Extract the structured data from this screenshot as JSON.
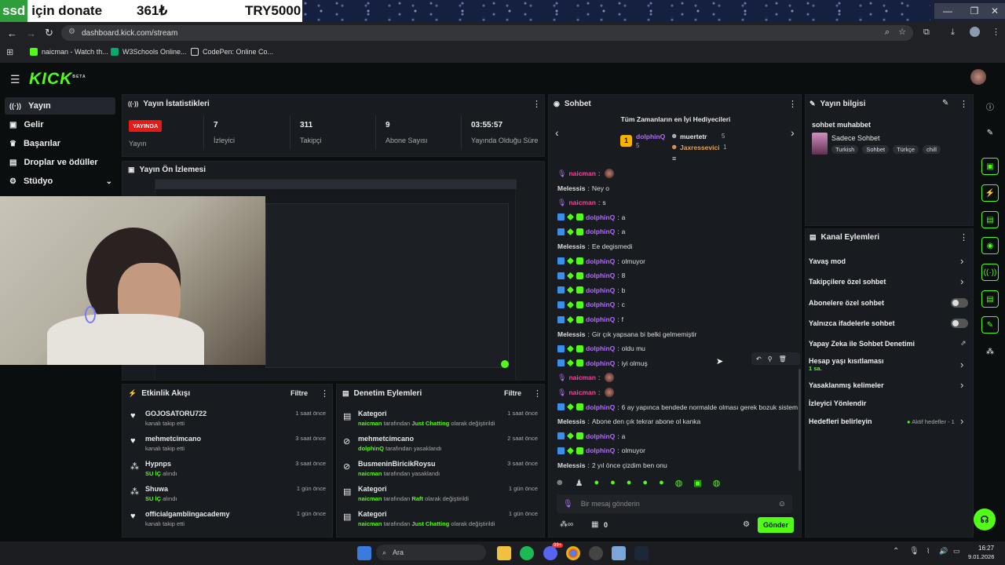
{
  "overlay": {
    "ssd": "ssd",
    "donate": "için donate",
    "amount1": "361₺",
    "amount2": "TRY5000"
  },
  "browser": {
    "url": "dashboard.kick.com/stream",
    "bookmarks": [
      "naicman - Watch th...",
      "W3Schools Online...",
      "CodePen: Online Co..."
    ]
  },
  "app": {
    "logo": "KICK",
    "logo_sup": "BETA"
  },
  "sidebar": {
    "items": [
      {
        "label": "Yayın",
        "icon": "broadcast-icon"
      },
      {
        "label": "Gelir",
        "icon": "wallet-icon"
      },
      {
        "label": "Başarılar",
        "icon": "trophy-icon"
      },
      {
        "label": "Droplar ve ödüller",
        "icon": "gift-icon"
      },
      {
        "label": "Stüdyo",
        "icon": "studio-icon"
      }
    ]
  },
  "stats": {
    "title": "Yayın İstatistikleri",
    "live_badge": "YAYINDA",
    "live_label": "Yayın",
    "items": [
      {
        "value": "7",
        "label": "İzleyici"
      },
      {
        "value": "311",
        "label": "Takipçi"
      },
      {
        "value": "9",
        "label": "Abone Sayısı"
      },
      {
        "value": "03:55:57",
        "label": "Yayında Olduğu Süre"
      }
    ]
  },
  "preview": {
    "title": "Yayın Ön İzlemesi"
  },
  "activity": {
    "title": "Etkinlik Akışı",
    "filter": "Filtre",
    "items": [
      {
        "name": "GOJOSATORU722",
        "sub": "kanalı takip etti",
        "time": "1 saat önce",
        "icon": "heart-icon",
        "subgreen": ""
      },
      {
        "name": "mehmetcimcano",
        "sub": "kanalı takip etti",
        "time": "3 saat önce",
        "icon": "heart-icon",
        "subgreen": ""
      },
      {
        "name": "Hypnps",
        "sub": "alındı",
        "time": "3 saat önce",
        "icon": "drop-icon",
        "subgreen": "SU İÇ"
      },
      {
        "name": "Shuwa",
        "sub": "alındı",
        "time": "1 gün önce",
        "icon": "drop-icon",
        "subgreen": "SU İÇ"
      },
      {
        "name": "officialgamblingacademy",
        "sub": "kanalı takip etti",
        "time": "1 gün önce",
        "icon": "heart-icon",
        "subgreen": ""
      }
    ]
  },
  "moderation": {
    "title": "Denetim Eylemleri",
    "filter": "Filtre",
    "items": [
      {
        "name": "Kategori",
        "actor": "naicman",
        "mid": "tarafından",
        "target": "Just Chatting",
        "tail": "olarak değiştirildi",
        "time": "1 saat önce",
        "icon": "category-icon"
      },
      {
        "name": "mehmetcimcano",
        "actor": "dolphinQ",
        "mid": "tarafından yasaklandı",
        "target": "",
        "tail": "",
        "time": "2 saat önce",
        "icon": "ban-icon"
      },
      {
        "name": "BusmeninBiricikRoysu",
        "actor": "naicman",
        "mid": "tarafından yasaklandı",
        "target": "",
        "tail": "",
        "time": "3 saat önce",
        "icon": "ban-icon"
      },
      {
        "name": "Kategori",
        "actor": "naicman",
        "mid": "tarafından",
        "target": "Raft",
        "tail": "olarak değiştirildi",
        "time": "1 gün önce",
        "icon": "category-icon"
      },
      {
        "name": "Kategori",
        "actor": "naicman",
        "mid": "tarafından",
        "target": "Just Chatting",
        "tail": "olarak değiştirildi",
        "time": "1 gün önce",
        "icon": "category-icon"
      }
    ]
  },
  "chat": {
    "title": "Sohbet",
    "top_title": "Tüm Zamanların en İyi Hediyecileri",
    "top_rank": "1",
    "top1_name": "dolphinQ",
    "top1_val": "5",
    "top2_name": "muertetr",
    "top2_val": "5",
    "top3_name": "Jaxressevici",
    "top3_val": "1",
    "placeholder": "Bir mesaj gönderin",
    "send": "Gönder",
    "footer_count": "0",
    "messages": [
      {
        "user": "naicman",
        "text": "",
        "type": "n"
      },
      {
        "user": "Melessis",
        "text": "Ney o",
        "type": "m"
      },
      {
        "user": "naicman",
        "text": "s",
        "type": "n"
      },
      {
        "user": "dolphinQ",
        "text": "a",
        "type": "p"
      },
      {
        "user": "dolphinQ",
        "text": "a",
        "type": "p"
      },
      {
        "user": "Melessis",
        "text": "Ee degismedi",
        "type": "m"
      },
      {
        "user": "dolphinQ",
        "text": "olmuyor",
        "type": "p"
      },
      {
        "user": "dolphinQ",
        "text": "8",
        "type": "p"
      },
      {
        "user": "dolphinQ",
        "text": "b",
        "type": "p"
      },
      {
        "user": "dolphinQ",
        "text": "c",
        "type": "p"
      },
      {
        "user": "dolphinQ",
        "text": "f",
        "type": "p"
      },
      {
        "user": "Melessis",
        "text": "Gir çık yapsana bi belki gelmemiştir",
        "type": "m"
      },
      {
        "user": "dolphinQ",
        "text": "oldu mu",
        "type": "p"
      },
      {
        "user": "dolphinQ",
        "text": "iyi olmuş",
        "type": "p"
      },
      {
        "user": "naicman",
        "text": "",
        "type": "n"
      },
      {
        "user": "naicman",
        "text": "",
        "type": "n"
      },
      {
        "user": "dolphinQ",
        "text": "6 ay yapınca bendede normalde olması gerek bozuk sistem",
        "type": "p"
      },
      {
        "user": "Melessis",
        "text": "Abone den çık tekrar abone ol kanka",
        "type": "m"
      },
      {
        "user": "dolphinQ",
        "text": "a",
        "type": "p"
      },
      {
        "user": "dolphinQ",
        "text": "olmuyor",
        "type": "p"
      },
      {
        "user": "Melessis",
        "text": "2 yıl önce çizdim ben onu",
        "type": "m"
      }
    ]
  },
  "info": {
    "title": "Yayın bilgisi",
    "stream_title": "sohbet muhabbet",
    "category": "Sadece Sohbet",
    "tags": [
      "Turkish",
      "Sohbet",
      "Türkçe",
      "chill"
    ]
  },
  "channel_actions": {
    "title": "Kanal Eylemleri",
    "items": [
      {
        "label": "Yavaş mod",
        "control": "chevron"
      },
      {
        "label": "Takipçilere özel sohbet",
        "control": "chevron"
      },
      {
        "label": "Abonelere özel sohbet",
        "control": "toggle"
      },
      {
        "label": "Yalnızca ifadelerle sohbet",
        "control": "toggle"
      },
      {
        "label": "Yapay Zeka ile Sohbet Denetimi",
        "control": "external"
      },
      {
        "label": "Hesap yaşı kısıtlaması",
        "control": "chevron"
      },
      {
        "label": "Yasaklanmış kelimeler",
        "control": "chevron"
      },
      {
        "label": "İzleyici Yönlendir",
        "control": "none"
      },
      {
        "label": "Hedefleri belirleyin",
        "control": "chevron"
      }
    ],
    "account_age_value": "1 sa.",
    "goals_status": "Aktif hedefler - 1"
  },
  "taskbar": {
    "search": "Ara",
    "time": "16:27",
    "date": "9.01.2026",
    "badge": "99+"
  },
  "colors": {
    "accent": "#53fc18",
    "live": "#e91916",
    "bg": "#0b0e0f",
    "panel": "#181b1f"
  }
}
